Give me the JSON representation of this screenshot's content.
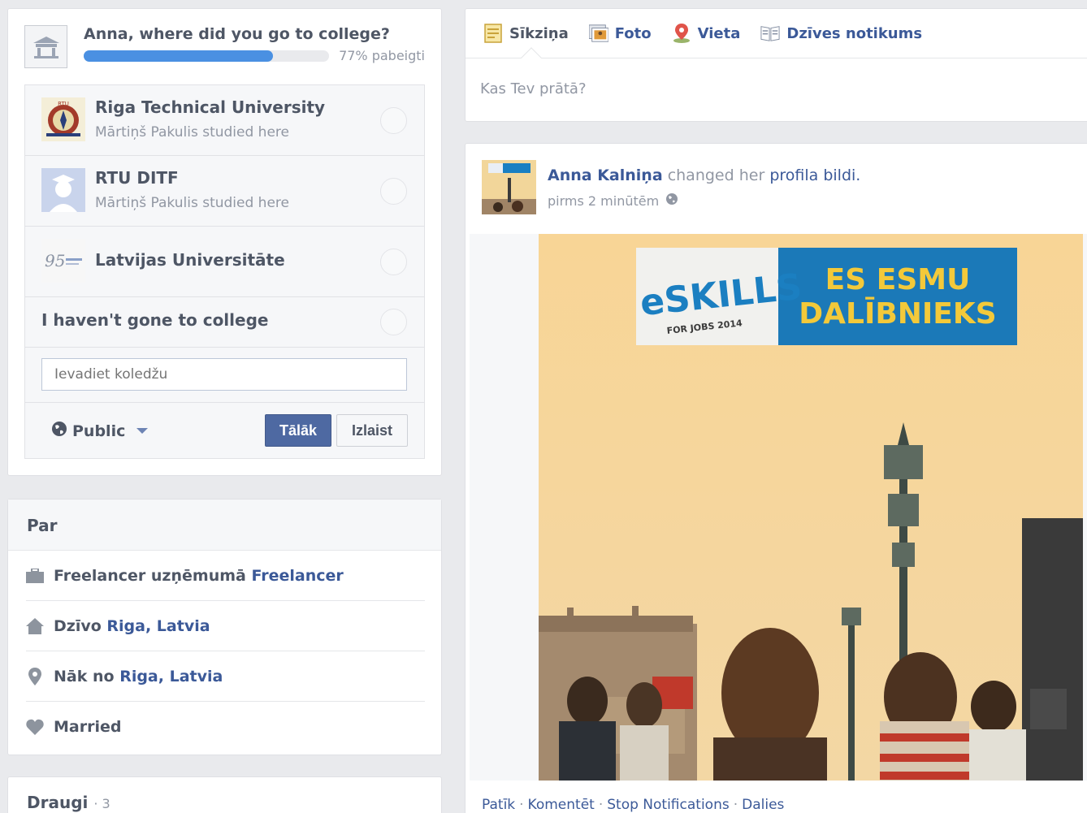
{
  "college": {
    "question": "Anna, where did you go to college?",
    "progress": 0.77,
    "progress_text": "77% pabeigti",
    "schools": [
      {
        "name": "Riga Technical University",
        "sub": "Mārtiņš Pakulis studied here"
      },
      {
        "name": "RTU DITF",
        "sub": "Mārtiņš Pakulis studied here"
      },
      {
        "name": "Latvijas Universitāte"
      }
    ],
    "none_label": "I haven't gone to college",
    "input_placeholder": "Ievadiet koledžu",
    "privacy": "Public",
    "next_label": "Tālāk",
    "skip_label": "Izlaist"
  },
  "about": {
    "title": "Par",
    "work_prefix": "Freelancer uzņēmumā",
    "work_link": "Freelancer",
    "lives_prefix": "Dzīvo",
    "lives_link": "Riga, Latvia",
    "from_prefix": "Nāk no",
    "from_link": "Riga, Latvia",
    "relationship": "Married"
  },
  "friends": {
    "title": "Draugi",
    "sep": "·",
    "count": "3"
  },
  "composer": {
    "tabs": [
      {
        "label": "Sīkziņa",
        "icon": "status-icon"
      },
      {
        "label": "Foto",
        "icon": "photo-icon"
      },
      {
        "label": "Vieta",
        "icon": "place-icon"
      },
      {
        "label": "Dzīves notikums",
        "icon": "life-event-icon"
      }
    ],
    "placeholder": "Kas Tev prātā?"
  },
  "story": {
    "author": "Anna Kalniņa",
    "action": "changed her",
    "link": "profila bildi.",
    "time": "pirms 2 minūtēm",
    "banner_left": "eSKILLS",
    "banner_left_sub": "FOR JOBS 2014",
    "banner_right_1": "ES ESMU",
    "banner_right_2": "DALĪBNIEKS",
    "actions": [
      "Patīk",
      "Komentēt",
      "Stop Notifications",
      "Dalies"
    ],
    "sep": "·"
  }
}
